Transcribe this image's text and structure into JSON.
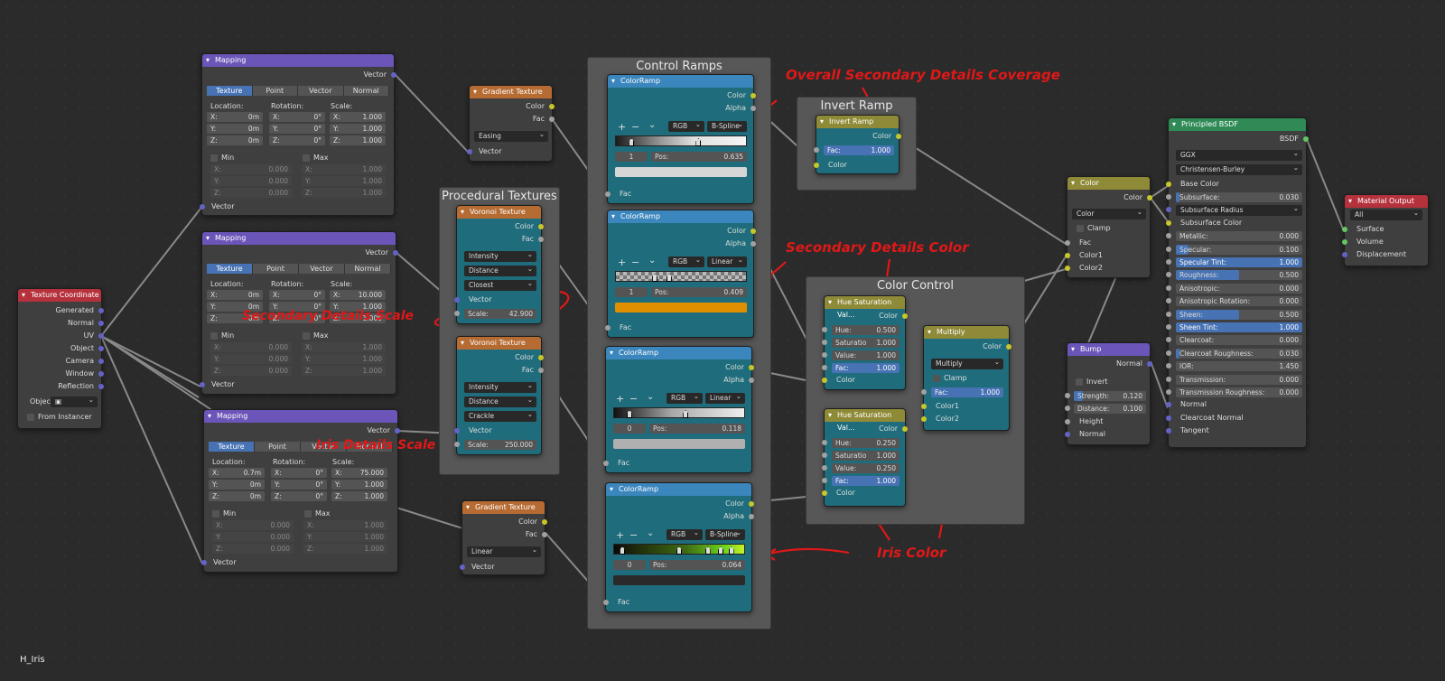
{
  "file_name": "H_Iris",
  "frames": {
    "control_ramps": "Control Ramps",
    "procedural": "Procedural Textures",
    "invert": "Invert Ramp",
    "color_control": "Color Control"
  },
  "annotations": {
    "overall": "Overall Secondary Details Coverage",
    "sec_color": "Secondary Details Color",
    "sec_scale": "Secondary Details Scale",
    "iris_scale": "Iris Details Scale",
    "iris_color": "Iris Color"
  },
  "texcoord": {
    "title": "Texture Coordinate",
    "outputs": [
      "Generated",
      "Normal",
      "UV",
      "Object",
      "Camera",
      "Window",
      "Reflection"
    ],
    "object_label": "Objec",
    "from_instancer": "From Instancer"
  },
  "mapping": [
    {
      "title": "Mapping",
      "out": "Vector",
      "tabs": [
        "Texture",
        "Point",
        "Vector",
        "Normal"
      ],
      "loc": "Location:",
      "rot": "Rotation:",
      "scale": "Scale:",
      "lx": "0m",
      "ly": "0m",
      "lz": "0m",
      "rx": "0°",
      "ry": "0°",
      "rz": "0°",
      "sx": "1.000",
      "sy": "1.000",
      "sz": "1.000",
      "min": "Min",
      "max": "Max",
      "minv": [
        "0.000",
        "0.000",
        "0.000"
      ],
      "maxv": [
        "1.000",
        "1.000",
        "1.000"
      ],
      "in": "Vector"
    },
    {
      "title": "Mapping",
      "out": "Vector",
      "tabs": [
        "Texture",
        "Point",
        "Vector",
        "Normal"
      ],
      "loc": "Location:",
      "rot": "Rotation:",
      "scale": "Scale:",
      "lx": "0m",
      "ly": "0m",
      "lz": "0m",
      "rx": "0°",
      "ry": "0°",
      "rz": "0°",
      "sx": "10.000",
      "sy": "1.000",
      "sz": "1.000",
      "min": "Min",
      "max": "Max",
      "minv": [
        "0.000",
        "0.000",
        "0.000"
      ],
      "maxv": [
        "1.000",
        "1.000",
        "1.000"
      ],
      "in": "Vector"
    },
    {
      "title": "Mapping",
      "out": "Vector",
      "tabs": [
        "Texture",
        "Point",
        "Vector",
        "Normal"
      ],
      "loc": "Location:",
      "rot": "Rotation:",
      "scale": "Scale:",
      "lx": "0.7m",
      "ly": "0m",
      "lz": "0m",
      "rx": "0°",
      "ry": "0°",
      "rz": "0°",
      "sx": "75.000",
      "sy": "1.000",
      "sz": "1.000",
      "min": "Min",
      "max": "Max",
      "minv": [
        "0.000",
        "0.000",
        "0.000"
      ],
      "maxv": [
        "1.000",
        "1.000",
        "1.000"
      ],
      "in": "Vector"
    }
  ],
  "axes": {
    "x": "X:",
    "y": "Y:",
    "z": "Z:"
  },
  "gradient1": {
    "title": "Gradient Texture",
    "color": "Color",
    "fac": "Fac",
    "mode": "Easing",
    "in": "Vector"
  },
  "gradient2": {
    "title": "Gradient Texture",
    "color": "Color",
    "fac": "Fac",
    "mode": "Linear",
    "in": "Vector"
  },
  "voronoi1": {
    "title": "Voronoi Texture",
    "color": "Color",
    "fac": "Fac",
    "o1": "Intensity",
    "o2": "Distance",
    "o3": "Closest",
    "in": "Vector",
    "scale_label": "Scale:",
    "scale": "42.900"
  },
  "voronoi2": {
    "title": "Voronoi Texture",
    "color": "Color",
    "fac": "Fac",
    "o1": "Intensity",
    "o2": "Distance",
    "o3": "Crackle",
    "in": "Vector",
    "scale_label": "Scale:",
    "scale": "250.000"
  },
  "ramps": [
    {
      "title": "ColorRamp",
      "color": "Color",
      "alpha": "Alpha",
      "mode": "RGB",
      "interp": "B-Spline",
      "idx": "1",
      "pos_label": "Pos:",
      "pos": "0.635",
      "fac": "Fac"
    },
    {
      "title": "ColorRamp",
      "color": "Color",
      "alpha": "Alpha",
      "mode": "RGB",
      "interp": "Linear",
      "idx": "1",
      "pos_label": "Pos:",
      "pos": "0.409",
      "fac": "Fac"
    },
    {
      "title": "ColorRamp",
      "color": "Color",
      "alpha": "Alpha",
      "mode": "RGB",
      "interp": "Linear",
      "idx": "0",
      "pos_label": "Pos:",
      "pos": "0.118",
      "fac": "Fac"
    },
    {
      "title": "ColorRamp",
      "color": "Color",
      "alpha": "Alpha",
      "mode": "RGB",
      "interp": "B-Spline",
      "idx": "0",
      "pos_label": "Pos:",
      "pos": "0.064",
      "fac": "Fac"
    }
  ],
  "ramp_buttons": {
    "add": "+",
    "remove": "−",
    "menu": "⌄"
  },
  "invert": {
    "title": "Invert Ramp",
    "color": "Color",
    "fac_label": "Fac:",
    "fac": "1.000",
    "in": "Color"
  },
  "hsv1": {
    "title": "Hue Saturation Val...",
    "color": "Color",
    "hue_l": "Hue:",
    "hue": "0.500",
    "sat_l": "Saturatio",
    "sat": "1.000",
    "val_l": "Value:",
    "val": "1.000",
    "fac_l": "Fac:",
    "fac": "1.000",
    "in": "Color"
  },
  "hsv2": {
    "title": "Hue Saturation Val...",
    "color": "Color",
    "hue_l": "Hue:",
    "hue": "0.250",
    "sat_l": "Saturatio",
    "sat": "1.000",
    "val_l": "Value:",
    "val": "0.250",
    "fac_l": "Fac:",
    "fac": "1.000",
    "in": "Color"
  },
  "multiply": {
    "title": "Multiply",
    "color": "Color",
    "mode": "Multiply",
    "clamp": "Clamp",
    "fac_l": "Fac:",
    "fac": "1.000",
    "c1": "Color1",
    "c2": "Color2"
  },
  "mix": {
    "title": "Color",
    "color": "Color",
    "mode": "Color",
    "clamp": "Clamp",
    "fac": "Fac",
    "c1": "Color1",
    "c2": "Color2"
  },
  "bump": {
    "title": "Bump",
    "normal_out": "Normal",
    "invert": "Invert",
    "strength_l": "Strength:",
    "strength": "0.120",
    "distance_l": "Distance:",
    "distance": "0.100",
    "height": "Height",
    "normal": "Normal"
  },
  "bsdf": {
    "title": "Principled BSDF",
    "out": "BSDF",
    "dist": "GGX",
    "sss": "Christensen-Burley",
    "base": "Base Color",
    "fields": [
      [
        "Subsurface:",
        "0.030"
      ],
      [
        "Subsurface Radius",
        ""
      ],
      [
        "Subsurface Color",
        ""
      ],
      [
        "Metallic:",
        "0.000"
      ],
      [
        "Specular:",
        "0.100"
      ],
      [
        "Specular Tint:",
        "1.000"
      ],
      [
        "Roughness:",
        "0.500"
      ],
      [
        "Anisotropic:",
        "0.000"
      ],
      [
        "Anisotropic Rotation:",
        "0.000"
      ],
      [
        "Sheen:",
        "0.500"
      ],
      [
        "Sheen Tint:",
        "1.000"
      ],
      [
        "Clearcoat:",
        "0.000"
      ],
      [
        "Clearcoat Roughness:",
        "0.030"
      ],
      [
        "IOR:",
        "1.450"
      ],
      [
        "Transmission:",
        "0.000"
      ],
      [
        "Transmission Roughness:",
        "0.000"
      ],
      [
        "Normal",
        ""
      ],
      [
        "Clearcoat Normal",
        ""
      ],
      [
        "Tangent",
        ""
      ]
    ]
  },
  "output": {
    "title": "Material Output",
    "target": "All",
    "surface": "Surface",
    "volume": "Volume",
    "displacement": "Displacement"
  },
  "colors": {
    "accent": "#4772b3",
    "teal": "#1f6d7c",
    "annotation": "#e01818",
    "ramp2": "#e08f00"
  }
}
